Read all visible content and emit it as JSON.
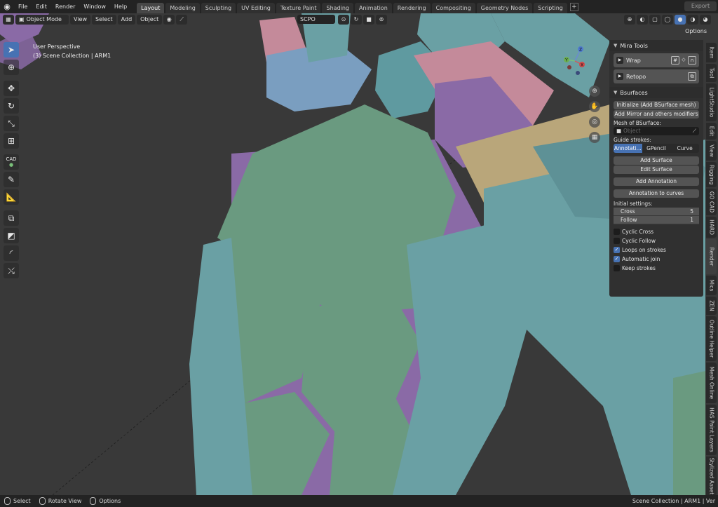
{
  "menubar": {
    "items": [
      "File",
      "Edit",
      "Render",
      "Window",
      "Help"
    ],
    "workspaces": [
      "Layout",
      "Modeling",
      "Sculpting",
      "UV Editing",
      "Texture Paint",
      "Shading",
      "Animation",
      "Rendering",
      "Compositing",
      "Geometry Nodes",
      "Scripting"
    ],
    "active_workspace": "Layout",
    "add_tab": "+",
    "export_label": "Export"
  },
  "viewport_header": {
    "mode": "Object Mode",
    "view": "View",
    "select": "Select",
    "add": "Add",
    "object": "Object",
    "scpo": "SCPO",
    "options": "Options"
  },
  "viewport": {
    "perspective": "User Perspective",
    "collection": "(3) Scene Collection | ARM1",
    "gizmo_axes": [
      "X",
      "Y",
      "Z"
    ],
    "colors": {
      "green": "#6a9a80",
      "purple": "#8a6aa6",
      "teal": "#6aa0a4",
      "pink": "#c48a9a",
      "tan": "#b9a67a",
      "blue": "#7a96c0",
      "background": "#393939"
    }
  },
  "toolbar": {
    "tools": [
      "select-box-icon",
      "cursor-icon",
      "move-icon",
      "rotate-icon",
      "scale-icon",
      "transform-icon",
      "cad-icon",
      "annotate-icon",
      "measure-icon",
      "add-cube-icon",
      "knife-icon",
      "bevel-icon",
      "gizmo-icon"
    ],
    "cad_label": "CAD"
  },
  "npanel": {
    "mira_title": "Mira Tools",
    "wrap": "Wrap",
    "retopo": "Retopo",
    "bsurfaces_title": "Bsurfaces",
    "init_btn": "Initialize (Add BSurface mesh)",
    "mirror_btn": "Add Mirror and others modifiers",
    "mesh_label": "Mesh of BSurface:",
    "object_placeholder": "Object",
    "guide_label": "Guide strokes:",
    "guide_opts": [
      "Annotati...",
      "GPencil",
      "Curve"
    ],
    "guide_active": "Annotati...",
    "add_surface": "Add Surface",
    "edit_surface": "Edit Surface",
    "add_annotation": "Add Annotation",
    "annot_to_curves": "Annotation to curves",
    "initial_label": "Initial settings:",
    "cross_label": "Cross",
    "cross_value": "5",
    "follow_label": "Follow",
    "follow_value": "1",
    "checkboxes": [
      {
        "label": "Cyclic Cross",
        "checked": false
      },
      {
        "label": "Cyclic Follow",
        "checked": false
      },
      {
        "label": "Loops on strokes",
        "checked": true
      },
      {
        "label": "Automatic join",
        "checked": true
      },
      {
        "label": "Keep strokes",
        "checked": false
      }
    ]
  },
  "vtabs": [
    "Item",
    "Tool",
    "LightStudio",
    "Edit",
    "View",
    "Rigging",
    "GO CAD",
    "HARD",
    "Render",
    "Mics",
    "ZEN",
    "Outline Helper",
    "Mesh Online",
    "HAS Paint Layers",
    "Stylized Asset"
  ],
  "statusbar": {
    "select": "Select",
    "rotate": "Rotate View",
    "options": "Options",
    "right": "Scene Collection | ARM1 | Ver"
  }
}
